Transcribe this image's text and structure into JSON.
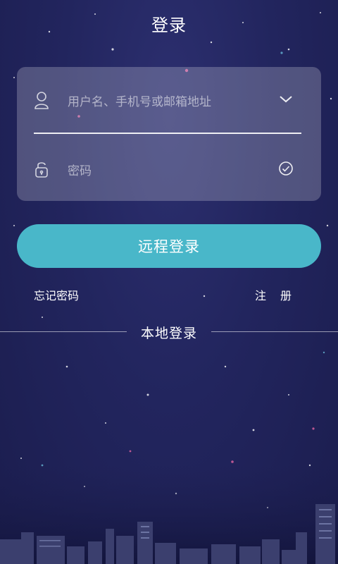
{
  "header": {
    "title": "登录"
  },
  "login_form": {
    "username_placeholder": "用户名、手机号或邮箱地址",
    "password_placeholder": "密码",
    "user_icon": "user-icon",
    "dropdown_icon": "chevron-down-icon",
    "lock_icon": "lock-icon",
    "check_icon": "check-circle-icon"
  },
  "actions": {
    "remote_login": "远程登录",
    "forgot_password": "忘记密码",
    "register": "注册"
  },
  "divider": {
    "label": "本地登录"
  },
  "colors": {
    "background": "#22255e",
    "primary_button": "#49b7c9",
    "card": "rgba(255,255,255,0.22)"
  }
}
